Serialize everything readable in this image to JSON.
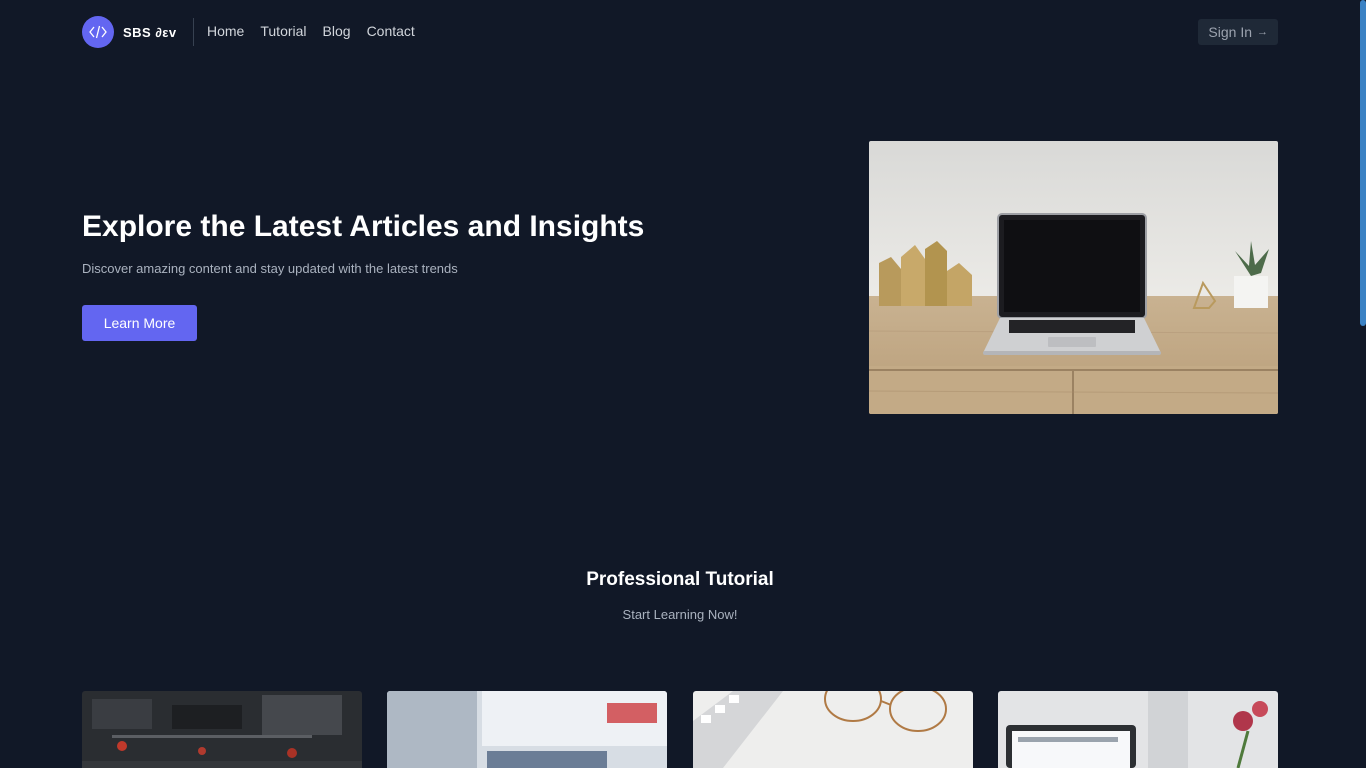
{
  "header": {
    "logo_text": "SBS ∂εv",
    "logo_icon": "code-icon",
    "nav": [
      "Home",
      "Tutorial",
      "Blog",
      "Contact"
    ],
    "signin_label": "Sign In",
    "signin_icon": "arrow-right-icon"
  },
  "hero": {
    "title": "Explore the Latest Articles and Insights",
    "subtitle": "Discover amazing content and stay updated with the latest trends",
    "button_label": "Learn More",
    "image": "laptop-desk-photo"
  },
  "section": {
    "title": "Professional Tutorial",
    "subtitle": "Start Learning Now!"
  },
  "cards": [
    {
      "image": "circuit-board-photo"
    },
    {
      "image": "monitor-screen-photo"
    },
    {
      "image": "keyboard-glasses-photo"
    },
    {
      "image": "laptop-flowers-photo"
    }
  ],
  "colors": {
    "background": "#111827",
    "accent": "#6366f1",
    "muted_text": "#aab2bf"
  }
}
